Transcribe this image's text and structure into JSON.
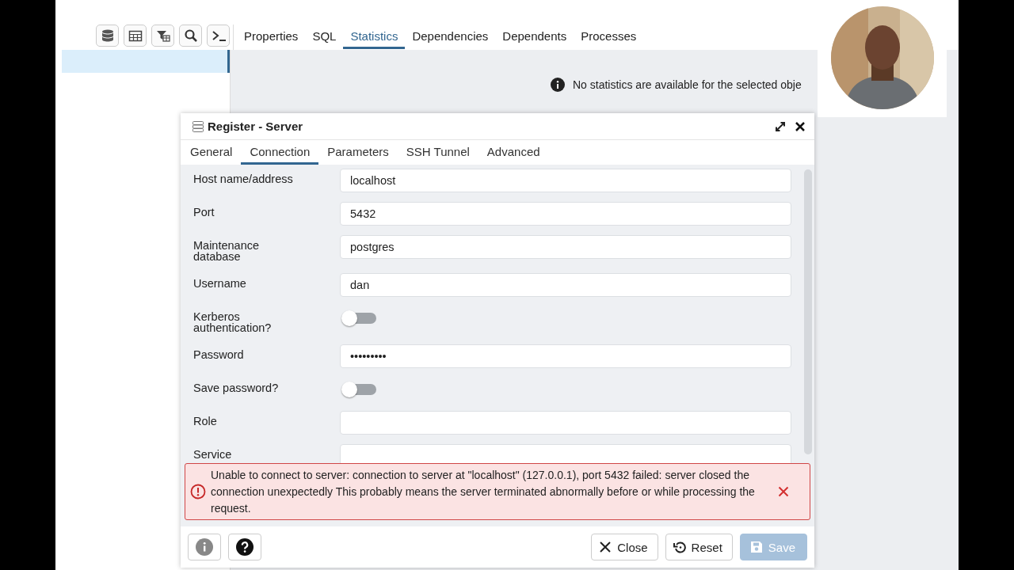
{
  "toolbar": {
    "tabs": [
      {
        "label": "Properties",
        "selected": false
      },
      {
        "label": "SQL",
        "selected": false
      },
      {
        "label": "Statistics",
        "selected": true
      },
      {
        "label": "Dependencies",
        "selected": false
      },
      {
        "label": "Dependents",
        "selected": false
      },
      {
        "label": "Processes",
        "selected": false
      }
    ]
  },
  "browser_tree": {
    "items": [
      {
        "selected": true
      }
    ]
  },
  "statistics_panel": {
    "message": "No statistics are available for the selected obje"
  },
  "dialog": {
    "title": "Register - Server",
    "tabs": [
      {
        "label": "General",
        "selected": false
      },
      {
        "label": "Connection",
        "selected": true
      },
      {
        "label": "Parameters",
        "selected": false
      },
      {
        "label": "SSH Tunnel",
        "selected": false
      },
      {
        "label": "Advanced",
        "selected": false
      }
    ],
    "fields": [
      {
        "label": "Host name/address",
        "kind": "text",
        "value": "localhost"
      },
      {
        "label": "Port",
        "kind": "text",
        "value": "5432"
      },
      {
        "label": "Maintenance database",
        "kind": "text",
        "value": "postgres"
      },
      {
        "label": "Username",
        "kind": "text",
        "value": "dan"
      },
      {
        "label": "Kerberos authentication?",
        "kind": "toggle",
        "on": false
      },
      {
        "label": "Password",
        "kind": "text",
        "value": "•••••••••"
      },
      {
        "label": "Save password?",
        "kind": "toggle",
        "on": false
      },
      {
        "label": "Role",
        "kind": "text"
      },
      {
        "label": "Service",
        "kind": "text"
      }
    ],
    "error": {
      "message": "Unable to connect to server: connection to server at \"localhost\" (127.0.0.1), port 5432 failed: server closed the connection unexpectedly This probably means the server terminated abnormally before or while processing the request."
    },
    "buttons": [
      {
        "label": "Close",
        "kind": "close",
        "disabled": false
      },
      {
        "label": "Reset",
        "kind": "reset",
        "disabled": false
      },
      {
        "label": "Save",
        "kind": "save",
        "disabled": true
      }
    ]
  }
}
